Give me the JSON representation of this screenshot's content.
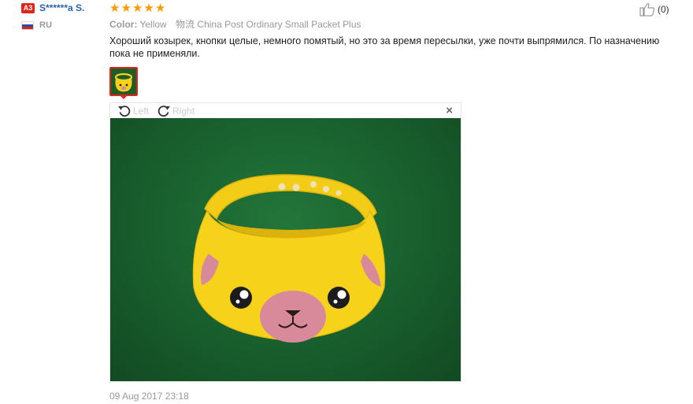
{
  "reviewer": {
    "level_badge": "A3",
    "name": "S******a S.",
    "country_code": "RU",
    "flag_colors": [
      "#ffffff",
      "#2450a4",
      "#d62718"
    ]
  },
  "review": {
    "rating": 5,
    "stars": [
      "★",
      "★",
      "★",
      "★",
      "★"
    ],
    "color_label": "Color:",
    "color_value": "Yellow",
    "shipping_label": "物流",
    "shipping_value": "China Post Ordinary Small Packet Plus",
    "text": "Хороший козырек, кнопки целые, немного помятый, но это за время пересылки, уже почти выпрямился. По назначению пока не применяли.",
    "date": "09 Aug 2017 23:18"
  },
  "helpful": {
    "icon": "thumbs-up-icon",
    "count_text": "(0)"
  },
  "viewer": {
    "rotate_left_label": "Left",
    "rotate_right_label": "Right",
    "close_label": "×"
  },
  "colors": {
    "accent_red": "#e1251b",
    "link_blue": "#2962b1",
    "star_orange": "#ff9900",
    "product_yellow": "#f7d21a"
  }
}
